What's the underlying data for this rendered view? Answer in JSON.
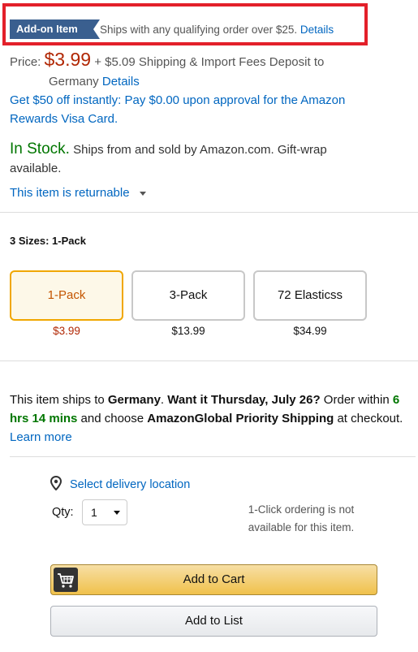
{
  "addon": {
    "badge": "Add-on Item",
    "text": "Ships with any qualifying order over $25.",
    "details_link": "Details"
  },
  "price": {
    "label": "Price:",
    "amount": "$3.99",
    "shipping_text_1": "+ $5.09 Shipping & Import Fees Deposit to",
    "shipping_text_2": "Germany",
    "details_link": "Details"
  },
  "promo": {
    "line1": "Get $50 off instantly: Pay $0.00 upon approval for the Amazon",
    "line2": "Rewards Visa Card."
  },
  "stock": {
    "status": "In Stock.",
    "text_1": "Ships from and sold by Amazon.com. Gift-wrap",
    "text_2": "available."
  },
  "returnable": {
    "label": "This item is returnable"
  },
  "sizes": {
    "title": "3 Sizes: 1-Pack",
    "options": [
      {
        "label": "1-Pack",
        "price": "$3.99"
      },
      {
        "label": "3-Pack",
        "price": "$13.99"
      },
      {
        "label": "72 Elasticss",
        "price": "$34.99"
      }
    ]
  },
  "shipping_info": {
    "t1": "This item ships to ",
    "country": "Germany",
    "t2": ". ",
    "want": "Want it Thursday, July 26?",
    "t3": " Order within ",
    "time": "6 hrs 14 mins",
    "t4": " and choose ",
    "method": "AmazonGlobal Priority Shipping",
    "t5": " at checkout. ",
    "learn_more": "Learn more"
  },
  "delivery": {
    "select_location": "Select delivery location"
  },
  "quantity": {
    "label": "Qty:",
    "value": "1"
  },
  "oneclick": {
    "line1": "1-Click ordering is not",
    "line2": "available for this item."
  },
  "buttons": {
    "add_to_cart": "Add to Cart",
    "add_to_list": "Add to List"
  },
  "colors": {
    "price_red": "#b12704",
    "stock_green": "#007600",
    "link_blue": "#0066c0",
    "addon_badge": "#3a5f8f",
    "highlight_red": "#e3202a",
    "cart_button_yellow": "#f0c14b"
  },
  "icons": [
    "location-pin-icon",
    "cart-icon",
    "caret-down-icon"
  ]
}
